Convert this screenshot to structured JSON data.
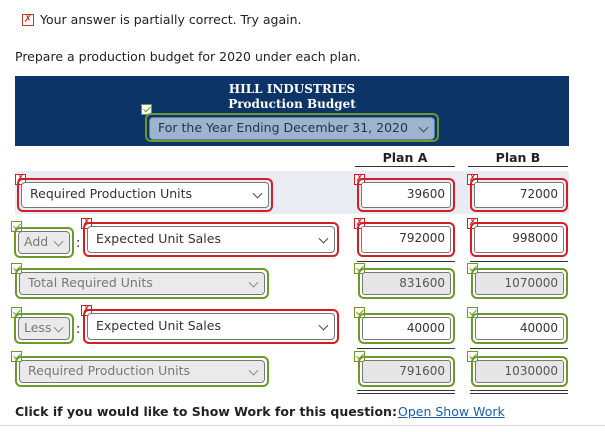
{
  "status": {
    "message": "Your answer is partially correct.  Try again.",
    "icon": "partial-correct-icon"
  },
  "instruction": "Prepare a production budget for 2020 under each plan.",
  "banner": {
    "company": "HILL INDUSTRIES",
    "title": "Production Budget",
    "period_selected": "For the Year Ending December 31, 2020",
    "color": "#0c3466"
  },
  "columns": {
    "plan_a": "Plan A",
    "plan_b": "Plan B"
  },
  "rows": [
    {
      "operator": "",
      "label": "Required Production Units",
      "plan_a": "39600",
      "plan_b": "72000"
    },
    {
      "operator": "Add",
      "label": "Expected Unit Sales",
      "plan_a": "792000",
      "plan_b": "998000"
    },
    {
      "operator": "",
      "label": "Total Required Units",
      "plan_a": "831600",
      "plan_b": "1070000"
    },
    {
      "operator": "Less",
      "label": "Expected Unit Sales",
      "plan_a": "40000",
      "plan_b": "40000"
    },
    {
      "operator": "",
      "label": "Required Production Units",
      "plan_a": "791600",
      "plan_b": "1030000"
    }
  ],
  "colon": ":",
  "footer": {
    "prompt": "Click if you would like to Show Work for this question:",
    "link": "Open Show Work"
  },
  "colors": {
    "incorrect": "#d21f26",
    "correct": "#6a9a2a"
  }
}
